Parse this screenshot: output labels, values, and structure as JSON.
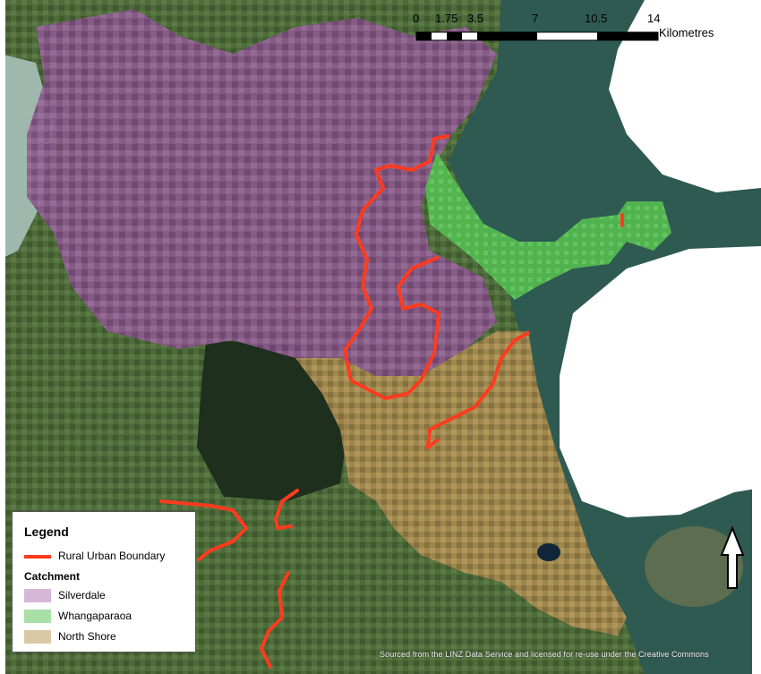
{
  "scalebar": {
    "ticks": [
      "0",
      "1.75",
      "3.5",
      "7",
      "10.5",
      "14"
    ],
    "unit": "Kilometres"
  },
  "legend": {
    "title": "Legend",
    "line_item": {
      "label": "Rural Urban Boundary",
      "color": "#ff3b1f"
    },
    "section_title": "Catchment",
    "items": [
      {
        "label": "Silverdale",
        "color": "#d7b6d8"
      },
      {
        "label": "Whangaparaoa",
        "color": "#a8e0a8"
      },
      {
        "label": "North Shore",
        "color": "#d9c8a4"
      }
    ]
  },
  "attribution": "Sourced from the LINZ Data Service and licensed for re-use under the Creative Commons",
  "colors": {
    "sea": "#2f5a52",
    "land": "#4d6a38",
    "forest": "#1f2f1e",
    "silverdale_overlay": "#8c4f8d",
    "whangaparaoa_overlay": "#4fc24f",
    "north_shore_overlay": "#b08a4a",
    "boundary": "#ff3b1f"
  },
  "north_arrow": "north-arrow-icon"
}
